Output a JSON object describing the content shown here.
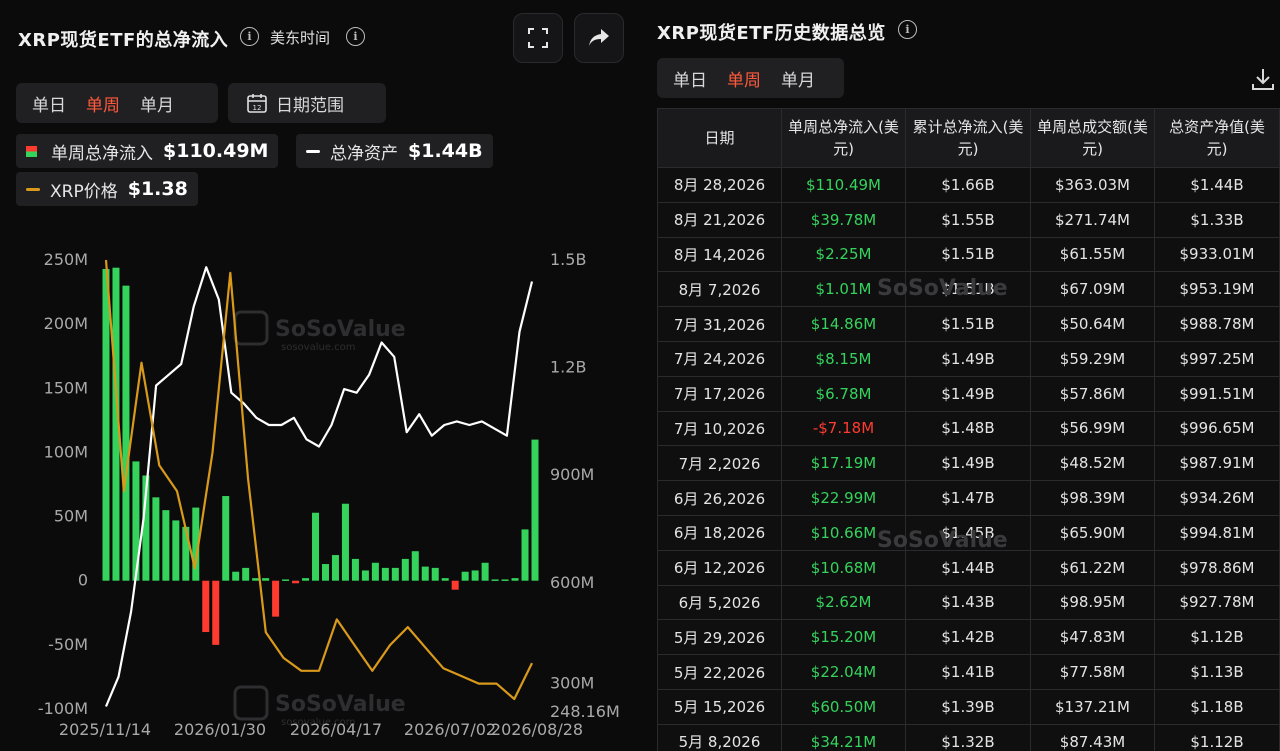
{
  "left": {
    "title": "XRP现货ETF的总净流入",
    "timezone": "美东时间",
    "tabs": [
      "单日",
      "单周",
      "单月"
    ],
    "active_tab": "单周",
    "date_range_label": "日期范围",
    "legend": {
      "net_inflow_label": "单周总净流入",
      "net_inflow_value": "$110.49M",
      "net_assets_label": "总净资产",
      "net_assets_value": "$1.44B",
      "price_label": "XRP价格",
      "price_value": "$1.38"
    },
    "icons": {
      "fullscreen": "fullscreen-icon",
      "share": "share-icon",
      "calendar": "calendar-icon"
    },
    "watermark": {
      "brand": "SoSoValue",
      "url": "sosovalue.com"
    }
  },
  "chart_data": {
    "type": "bar",
    "y_left_ticks": [
      "250M",
      "200M",
      "150M",
      "100M",
      "50M",
      "0",
      "-50M",
      "-100M"
    ],
    "y_right_ticks": [
      "1.5B",
      "1.2B",
      "900M",
      "600M",
      "300M",
      "248.16M"
    ],
    "x_ticks": [
      "2025/11/14",
      "2026/01/30",
      "2026/04/17",
      "2026/07/02",
      "2026/08/28"
    ],
    "ylim_left": [
      -100,
      250
    ],
    "ylim_right": [
      248.16,
      1500
    ],
    "series": [
      {
        "name": "单周总净流入",
        "color_pos": "#35d35c",
        "color_neg": "#ff3b30",
        "values": [
          243,
          244,
          230,
          93,
          82,
          65,
          55,
          47,
          42,
          57,
          -40,
          -50,
          66,
          7,
          10,
          2,
          2,
          -28,
          1,
          -2,
          2,
          53,
          13,
          20,
          60,
          17,
          8,
          14,
          10,
          10,
          17,
          23,
          11,
          10,
          2,
          -7,
          7,
          8,
          14,
          1,
          1,
          2,
          40,
          110
        ]
      },
      {
        "name": "总净资产",
        "color": "#ffffff",
        "values": [
          255,
          338,
          520,
          780,
          1150,
          1180,
          1210,
          1370,
          1480,
          1390,
          1130,
          1100,
          1060,
          1040,
          1040,
          1060,
          1000,
          980,
          1040,
          1140,
          1130,
          1180,
          1270,
          1230,
          1020,
          1070,
          1010,
          1040,
          1050,
          1040,
          1050,
          1030,
          1010,
          1300,
          1440
        ]
      },
      {
        "name": "XRP价格",
        "color": "#d99a1b",
        "values": [
          2.95,
          2.05,
          2.55,
          2.15,
          2.05,
          1.75,
          2.2,
          2.9,
          2.1,
          1.5,
          1.4,
          1.35,
          1.35,
          1.55,
          1.45,
          1.35,
          1.45,
          1.52,
          1.44,
          1.36,
          1.33,
          1.3,
          1.3,
          1.24,
          1.38
        ]
      }
    ]
  },
  "right": {
    "title": "XRP现货ETF历史数据总览",
    "tabs": [
      "单日",
      "单周",
      "单月"
    ],
    "active_tab": "单周",
    "download_icon": "download-icon",
    "columns": [
      "日期",
      "单周总净流入(美元)",
      "累计总净流入(美元)",
      "单周总成交额(美元)",
      "总资产净值(美元)"
    ],
    "rows": [
      [
        "8月 28,2026",
        "$110.49M",
        "$1.66B",
        "$363.03M",
        "$1.44B"
      ],
      [
        "8月 21,2026",
        "$39.78M",
        "$1.55B",
        "$271.74M",
        "$1.33B"
      ],
      [
        "8月 14,2026",
        "$2.25M",
        "$1.51B",
        "$61.55M",
        "$933.01M"
      ],
      [
        "8月 7,2026",
        "$1.01M",
        "$1.51B",
        "$67.09M",
        "$953.19M"
      ],
      [
        "7月 31,2026",
        "$14.86M",
        "$1.51B",
        "$50.64M",
        "$988.78M"
      ],
      [
        "7月 24,2026",
        "$8.15M",
        "$1.49B",
        "$59.29M",
        "$997.25M"
      ],
      [
        "7月 17,2026",
        "$6.78M",
        "$1.49B",
        "$57.86M",
        "$991.51M"
      ],
      [
        "7月 10,2026",
        "-$7.18M",
        "$1.48B",
        "$56.99M",
        "$996.65M"
      ],
      [
        "7月 2,2026",
        "$17.19M",
        "$1.49B",
        "$48.52M",
        "$987.91M"
      ],
      [
        "6月 26,2026",
        "$22.99M",
        "$1.47B",
        "$98.39M",
        "$934.26M"
      ],
      [
        "6月 18,2026",
        "$10.66M",
        "$1.45B",
        "$65.90M",
        "$994.81M"
      ],
      [
        "6月 12,2026",
        "$10.68M",
        "$1.44B",
        "$61.22M",
        "$978.86M"
      ],
      [
        "6月 5,2026",
        "$2.62M",
        "$1.43B",
        "$98.95M",
        "$927.78M"
      ],
      [
        "5月 29,2026",
        "$15.20M",
        "$1.42B",
        "$47.83M",
        "$1.12B"
      ],
      [
        "5月 22,2026",
        "$22.04M",
        "$1.41B",
        "$77.58M",
        "$1.13B"
      ],
      [
        "5月 15,2026",
        "$60.50M",
        "$1.39B",
        "$137.21M",
        "$1.18B"
      ],
      [
        "5月 8,2026",
        "$34.21M",
        "$1.32B",
        "$87.43M",
        "$1.12B"
      ]
    ]
  }
}
